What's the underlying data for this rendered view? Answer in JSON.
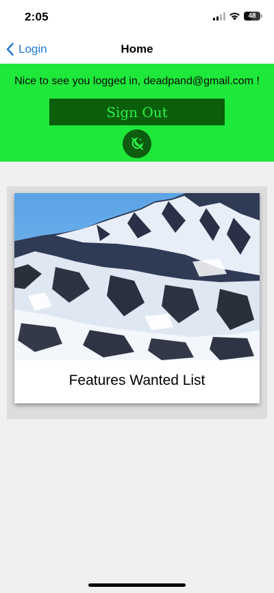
{
  "status_bar": {
    "time": "2:05",
    "battery": "48",
    "icons": [
      "cellular-signal-icon",
      "wifi-icon",
      "battery-icon"
    ]
  },
  "nav": {
    "back_label": "Login",
    "title": "Home"
  },
  "banner": {
    "welcome_text": "Nice to see you logged in, deadpand@gmail.com !",
    "sign_out_label": "Sign Out",
    "theme_toggle_icon": "dark-mode-toggle-icon",
    "background_color": "#1ee83a",
    "button_color": "#0b5f0b"
  },
  "card": {
    "image_icon": "snowy-mountain-image",
    "title": "Features Wanted List"
  }
}
